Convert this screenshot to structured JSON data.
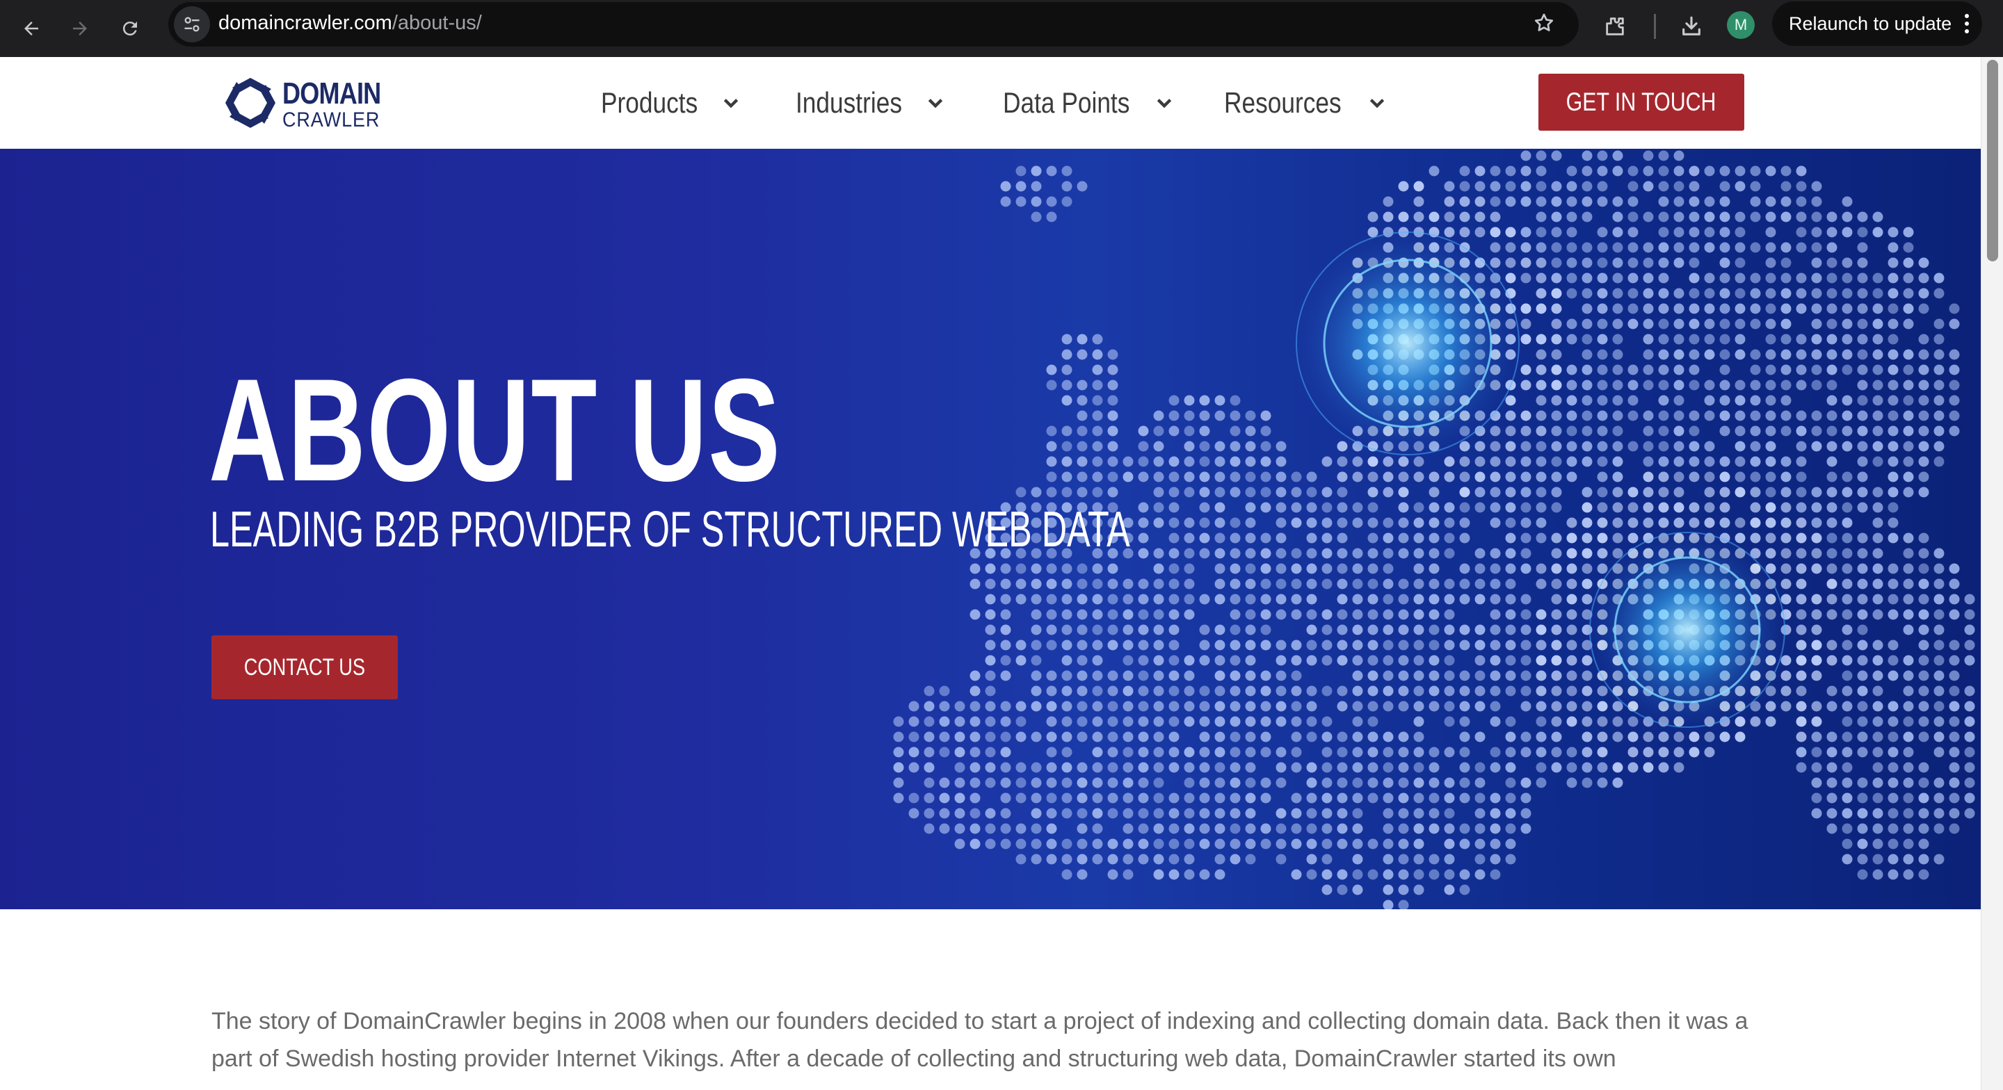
{
  "browser": {
    "url_host": "domaincrawler.com",
    "url_path": "/about-us/",
    "profile_initial": "M",
    "relaunch_label": "Relaunch to update",
    "icons": [
      "back-arrow-icon",
      "forward-arrow-icon",
      "reload-icon",
      "site-info-icon",
      "star-icon",
      "extensions-icon",
      "download-icon",
      "more-vert-icon"
    ]
  },
  "header": {
    "logo_line1": "DOMAIN",
    "logo_line2": "CRAWLER",
    "menu": [
      {
        "label": "Products"
      },
      {
        "label": "Industries"
      },
      {
        "label": "Data Points"
      },
      {
        "label": "Resources"
      }
    ],
    "cta_label": "GET IN TOUCH"
  },
  "hero": {
    "title": "ABOUT US",
    "subtitle": "LEADING B2B PROVIDER OF STRUCTURED WEB DATA",
    "cta_label": "CONTACT US"
  },
  "body": {
    "story": "The story of DomainCrawler begins in 2008 when our founders decided to start a project of indexing and collecting domain data. Back then it was a part of Swedish hosting provider Internet Vikings. After a decade of collecting and structuring web data, DomainCrawler started its own"
  },
  "colors": {
    "brand_navy": "#1c2a66",
    "cta_red": "#a5272d",
    "hero_blue": "#1f2c9f"
  }
}
